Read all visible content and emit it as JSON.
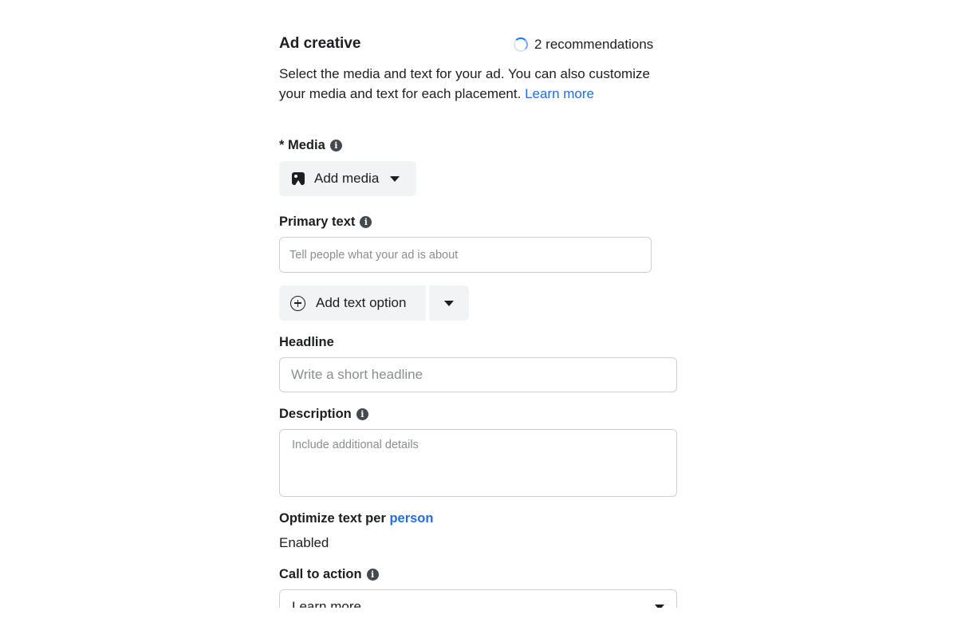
{
  "header": {
    "title": "Ad creative",
    "recommendations": "2 recommendations",
    "intro_text": "Select the media and text for your ad. You can also customize your media and text for each placement. ",
    "learn_more": "Learn more"
  },
  "media": {
    "label": "* Media",
    "button_label": "Add media"
  },
  "primary_text": {
    "label": "Primary text",
    "placeholder": "Tell people what your ad is about",
    "add_option_label": "Add text option"
  },
  "headline": {
    "label": "Headline",
    "placeholder": "Write a short headline"
  },
  "description": {
    "label": "Description",
    "placeholder": "Include additional details"
  },
  "optimize": {
    "label_prefix": "Optimize text per ",
    "label_link": "person",
    "status": "Enabled"
  },
  "call_to_action": {
    "label": "Call to action",
    "selected": "Learn more"
  },
  "colors": {
    "link": "#216fdb",
    "button_bg": "#f2f3f5",
    "border": "#ccd0d5"
  },
  "icons": {
    "info": "info-icon",
    "media": "image-icon",
    "add": "plus-circle-icon",
    "dropdown": "caret-down-icon",
    "loading": "spinner-icon"
  }
}
